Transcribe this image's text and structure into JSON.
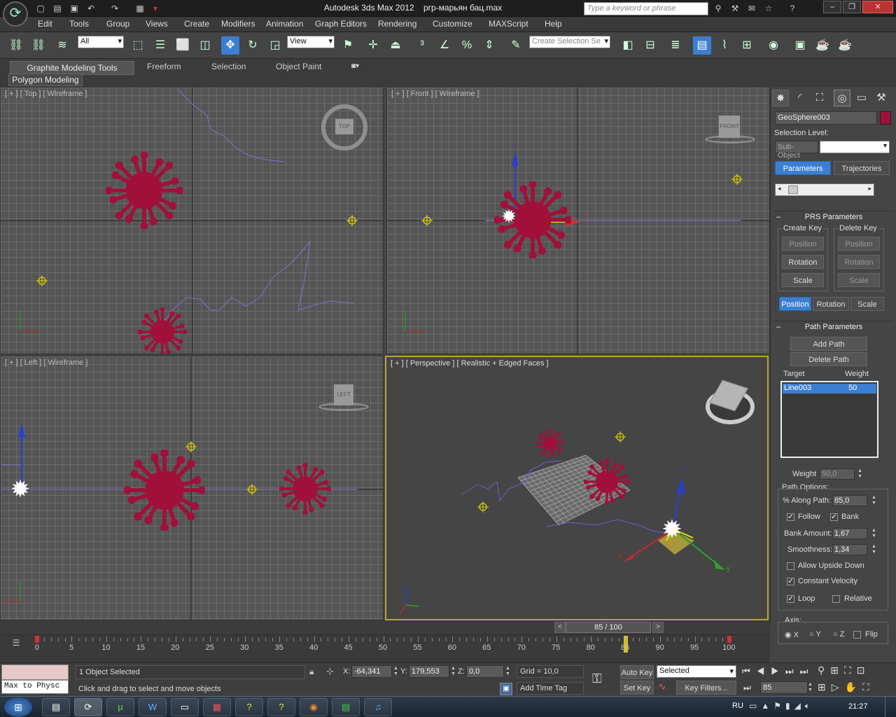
{
  "titlebar": {
    "app_title": "Autodesk 3ds Max 2012",
    "file_title": "ргр-марьян бац.max",
    "search_placeholder": "Type a keyword or phrase"
  },
  "menu": [
    "Edit",
    "Tools",
    "Group",
    "Views",
    "Create",
    "Modifiers",
    "Animation",
    "Graph Editors",
    "Rendering",
    "Customize",
    "MAXScript",
    "Help"
  ],
  "toolbar": {
    "selection_filter": "All",
    "ref_coord": "View",
    "named_selection": "Create Selection Se"
  },
  "ribbon": {
    "tabs": [
      "Graphite Modeling Tools",
      "Freeform",
      "Selection",
      "Object Paint"
    ],
    "panel": "Polygon Modeling"
  },
  "viewports": {
    "top": {
      "label": "[ + ] [ Top ] [ Wireframe ]",
      "cube": "TOP"
    },
    "front": {
      "label": "[ + ] [ Front ] [ Wireframe ]",
      "cube": "FRONT"
    },
    "left": {
      "label": "[ + ] [ Left ] [ Wireframe ]",
      "cube": "LEFT"
    },
    "perspective": {
      "label": "[ + ] [ Perspective ] [ Realistic + Edged Faces ]"
    }
  },
  "axis_labels": {
    "x": "x",
    "y": "y",
    "z": "z"
  },
  "command_panel": {
    "object_name": "GeoSphere003",
    "object_color": "#a0103a",
    "selection_level_label": "Selection Level:",
    "sub_object": "Sub-Object",
    "tabs": {
      "parameters": "Parameters",
      "trajectories": "Trajectories"
    },
    "prs": {
      "title": "PRS Parameters",
      "create_key": "Create Key",
      "delete_key": "Delete Key",
      "position": "Position",
      "rotation": "Rotation",
      "scale": "Scale"
    },
    "path": {
      "title": "Path Parameters",
      "add_path": "Add Path",
      "delete_path": "Delete Path",
      "target_header": "Target",
      "weight_header": "Weight",
      "target_name": "Line003",
      "target_weight": "50",
      "weight_label": "Weight",
      "weight_value": "50,0",
      "options_label": "Path Options:",
      "along_label": "% Along Path:",
      "along_value": "85,0",
      "follow": "Follow",
      "bank": "Bank",
      "bank_amount_label": "Bank Amount:",
      "bank_amount": "1,67",
      "smoothness_label": "Smoothness:",
      "smoothness": "1,34",
      "allow_upside_down": "Allow Upside Down",
      "constant_velocity": "Constant Velocity",
      "loop": "Loop",
      "relative": "Relative",
      "axis_label": "Axis:",
      "x": "X",
      "y": "Y",
      "z": "Z",
      "flip": "Flip"
    }
  },
  "timeline": {
    "frame_display": "85 / 100",
    "current_frame": 85,
    "total_frames": 100,
    "ticks": [
      "0",
      "5",
      "10",
      "15",
      "20",
      "25",
      "30",
      "35",
      "40",
      "45",
      "50",
      "55",
      "60",
      "65",
      "70",
      "75",
      "80",
      "85",
      "90",
      "95",
      "100"
    ]
  },
  "status": {
    "listener": "Max to Physc",
    "selection": "1 Object Selected",
    "prompt": "Click and drag to select and move objects",
    "x_label": "X:",
    "x_value": "-64,341",
    "y_label": "Y:",
    "y_value": "179,553",
    "z_label": "Z:",
    "z_value": "0,0",
    "grid": "Grid = 10,0",
    "add_time_tag": "Add Time Tag",
    "auto_key": "Auto Key",
    "set_key": "Set Key",
    "key_mode": "Selected",
    "key_filters": "Key Filters...",
    "frame_field": "85"
  },
  "taskbar": {
    "lang": "RU",
    "clock": "21:27"
  },
  "colors": {
    "accent": "#3b7fd0",
    "virus": "#a0103a",
    "path": "#8a6ccc",
    "active_border": "#b8a235"
  }
}
